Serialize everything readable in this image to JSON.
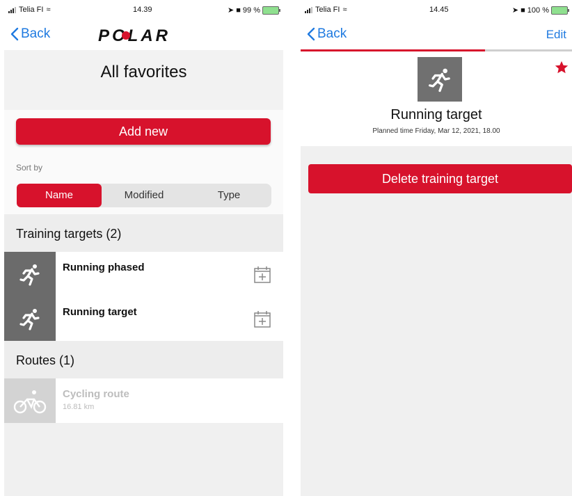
{
  "left": {
    "status": {
      "carrier": "Telia FI",
      "time": "14.39",
      "battery": "99 %"
    },
    "nav": {
      "back_label": "Back",
      "logo_text": "POLAR"
    },
    "title": "All favorites",
    "add_new_label": "Add new",
    "sort_by_label": "Sort by",
    "sort_options": [
      "Name",
      "Modified",
      "Type"
    ],
    "sort_selected": "Name",
    "sections": [
      {
        "header": "Training targets (2)",
        "items": [
          {
            "name": "Running phased",
            "icon": "running-icon",
            "action_icon": "calendar-add-icon"
          },
          {
            "name": "Running target",
            "icon": "running-icon",
            "action_icon": "calendar-add-icon"
          }
        ]
      },
      {
        "header": "Routes (1)",
        "items": [
          {
            "name": "Cycling route",
            "subtitle": "16.81 km",
            "icon": "cycling-icon",
            "disabled": true
          }
        ]
      }
    ]
  },
  "right": {
    "status": {
      "carrier": "Telia FI",
      "time": "14.45",
      "battery": "100 %"
    },
    "nav": {
      "back_label": "Back",
      "edit_label": "Edit"
    },
    "progress_fraction": 0.68,
    "target": {
      "icon": "running-icon",
      "name": "Running target",
      "planned": "Planned time Friday, Mar 12, 2021, 18.00",
      "favorite": true
    },
    "delete_label": "Delete training target"
  },
  "colors": {
    "accent_red": "#d7122c",
    "ios_blue": "#1f7ae0",
    "thumb_gray": "#6b6b6b"
  }
}
